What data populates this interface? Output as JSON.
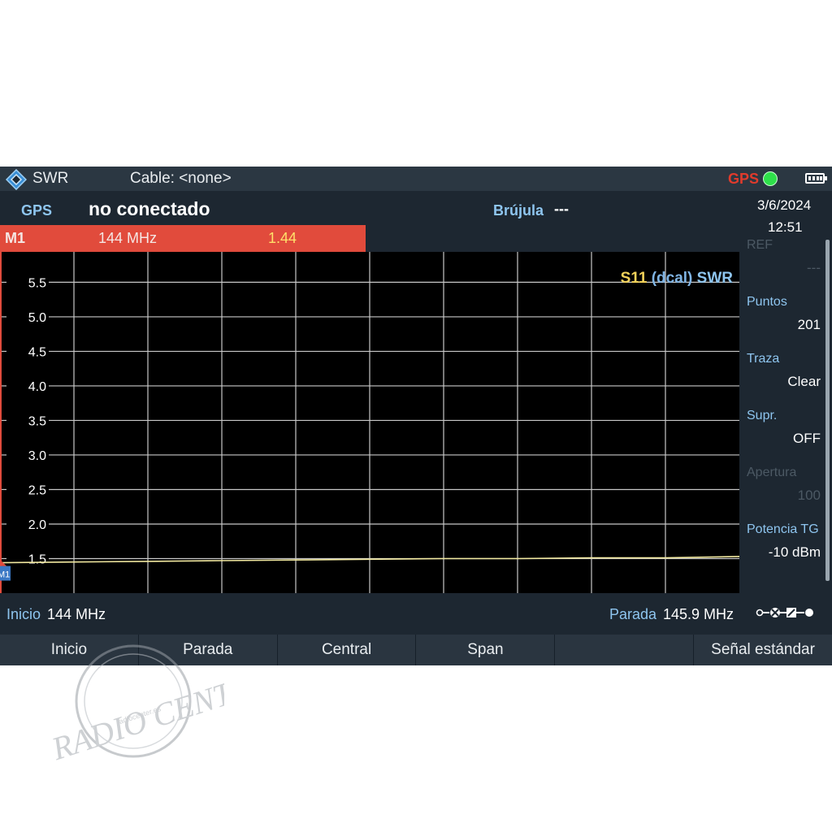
{
  "title_bar": {
    "mode": "SWR",
    "cable": "Cable: <none>",
    "gps_indicator": "GPS",
    "app_icon": "rs-diamond-icon",
    "battery_icon": "battery-icon"
  },
  "info": {
    "gps_key": "GPS",
    "gps_value": "no conectado",
    "compass_key": "Brújula",
    "compass_value": "---"
  },
  "marker": {
    "name": "M1",
    "frequency": "144 MHz",
    "value": "1.44",
    "tag": "M1"
  },
  "datetime": {
    "date": "3/6/2024",
    "time": "12:51"
  },
  "side_panel": [
    {
      "key": "REF",
      "value": "---",
      "dimmed": true
    },
    {
      "key": "Puntos",
      "value": "201",
      "dimmed": false
    },
    {
      "key": "Traza",
      "value": "Clear",
      "dimmed": false
    },
    {
      "key": "Supr.",
      "value": "OFF",
      "dimmed": false
    },
    {
      "key": "Apertura",
      "value": "100",
      "dimmed": true
    },
    {
      "key": "Potencia TG",
      "value": "-10 dBm",
      "dimmed": false
    }
  ],
  "frequency_bar": {
    "start_key": "Inicio",
    "start_value": "144 MHz",
    "stop_key": "Parada",
    "stop_value": "145.9 MHz"
  },
  "softkeys": [
    "Inicio",
    "Parada",
    "Central",
    "Span",
    "",
    "Señal estándar"
  ],
  "watermark": {
    "text": "RADIO CENTER",
    "url": "radiocenter.es"
  },
  "chart_data": {
    "type": "line",
    "trace_label": {
      "s11": "S11",
      "dcal": "(dcal)",
      "swr": "SWR"
    },
    "y_ticks": [
      "5.5",
      "5.0",
      "4.5",
      "4.0",
      "3.5",
      "3.0",
      "2.5",
      "2.0",
      "1.5"
    ],
    "ylim": [
      1.0,
      5.94
    ],
    "xlim": [
      144.0,
      145.9
    ],
    "x_divisions": 10,
    "grid": true,
    "colors": {
      "trace": "#f2e9a0",
      "grid": "#c8c8c8",
      "background": "#000000"
    },
    "series": [
      {
        "x": [
          144.0,
          144.19,
          144.38,
          144.57,
          144.76,
          144.95,
          145.14,
          145.33,
          145.52,
          145.71,
          145.9
        ],
        "values": [
          1.44,
          1.45,
          1.46,
          1.47,
          1.48,
          1.49,
          1.5,
          1.5,
          1.51,
          1.51,
          1.53
        ]
      }
    ]
  }
}
